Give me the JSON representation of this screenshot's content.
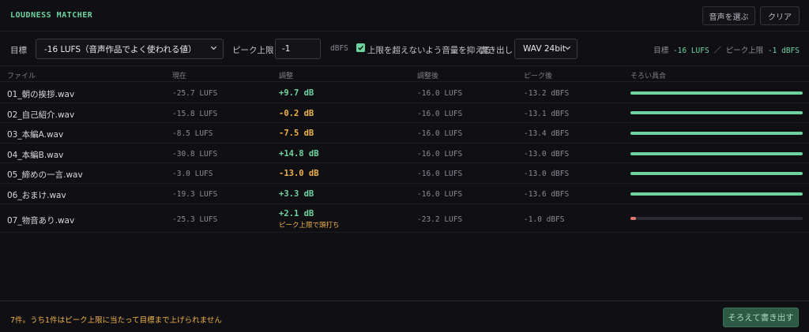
{
  "header": {
    "title": "LOUDNESS MATCHER",
    "choose_button": "音声を選ぶ",
    "clear_button": "クリア"
  },
  "toolbar": {
    "target_label": "目標",
    "target_value": "-16 LUFS（音声作品でよく使われる値）",
    "peak_label": "ピーク上限",
    "peak_value": "-1",
    "peak_unit": "dBFS",
    "limit_checked": true,
    "limit_label": "上限を超えないよう音量を抑える",
    "export_label": "書き出し",
    "export_value": "WAV 24bit",
    "summary": {
      "target_label": "目標",
      "target_value": "-16 LUFS",
      "separator": "／",
      "peak_label": "ピーク上限",
      "peak_value": "-1 dBFS"
    }
  },
  "table": {
    "headers": [
      "ファイル",
      "現在",
      "調整",
      "調整後",
      "ピーク後",
      "そろい具合"
    ],
    "rows": [
      {
        "file": "01_朝の挨拶.wav",
        "current": "-25.7 LUFS",
        "adjust": "+9.7 dB",
        "adjust_sign": "pos",
        "after": "-16.0 LUFS",
        "peak": "-13.2 dBFS",
        "match": 1.0,
        "match_color": "#6fd3a0",
        "note": ""
      },
      {
        "file": "02_自己紹介.wav",
        "current": "-15.8 LUFS",
        "adjust": "-0.2 dB",
        "adjust_sign": "neg",
        "after": "-16.0 LUFS",
        "peak": "-13.1 dBFS",
        "match": 1.0,
        "match_color": "#6fd3a0",
        "note": ""
      },
      {
        "file": "03_本編A.wav",
        "current": "-8.5 LUFS",
        "adjust": "-7.5 dB",
        "adjust_sign": "neg",
        "after": "-16.0 LUFS",
        "peak": "-13.4 dBFS",
        "match": 1.0,
        "match_color": "#6fd3a0",
        "note": ""
      },
      {
        "file": "04_本編B.wav",
        "current": "-30.8 LUFS",
        "adjust": "+14.8 dB",
        "adjust_sign": "pos",
        "after": "-16.0 LUFS",
        "peak": "-13.0 dBFS",
        "match": 1.0,
        "match_color": "#6fd3a0",
        "note": ""
      },
      {
        "file": "05_締めの一言.wav",
        "current": "-3.0 LUFS",
        "adjust": "-13.0 dB",
        "adjust_sign": "neg",
        "after": "-16.0 LUFS",
        "peak": "-13.0 dBFS",
        "match": 1.0,
        "match_color": "#6fd3a0",
        "note": ""
      },
      {
        "file": "06_おまけ.wav",
        "current": "-19.3 LUFS",
        "adjust": "+3.3 dB",
        "adjust_sign": "pos",
        "after": "-16.0 LUFS",
        "peak": "-13.6 dBFS",
        "match": 1.0,
        "match_color": "#6fd3a0",
        "note": ""
      },
      {
        "file": "07_物音あり.wav",
        "current": "-25.3 LUFS",
        "adjust": "+2.1 dB",
        "adjust_sign": "pos",
        "after": "-23.2 LUFS",
        "peak": "-1.0 dBFS",
        "match": 0.03,
        "match_color": "#e0766f",
        "note": "ピーク上限で頭打ち"
      }
    ]
  },
  "footer": {
    "message": "7件。うち1件はピーク上限に当たって目標まで上げられません",
    "export_button": "そろえて書き出す"
  },
  "colors": {
    "accent": "#6fd3a0",
    "warning": "#f0b24a",
    "error_bar": "#e0766f"
  }
}
